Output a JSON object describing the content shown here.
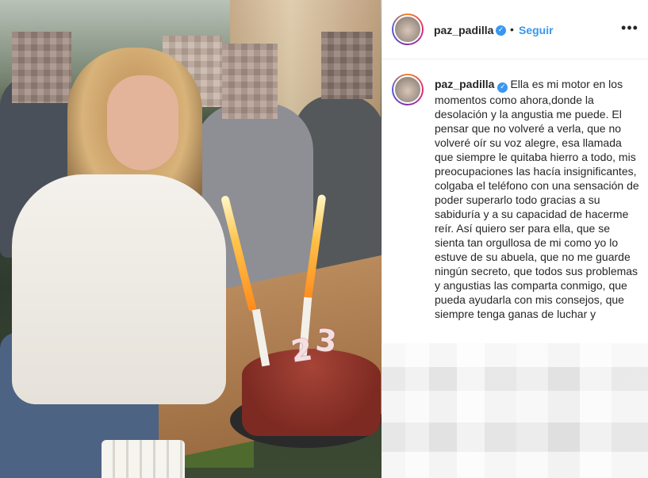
{
  "post": {
    "username": "paz_padilla",
    "follow_label": "Seguir",
    "dot_separator": "•",
    "more_icon": "more-horizontal-icon",
    "verified_icon": "verified-badge-icon",
    "caption": "Ella es mi motor en los momentos como ahora,donde la desolación y la angustia me puede. El pensar que no volveré a verla, que no volveré oír su voz alegre, esa llamada que siempre le quitaba hierro a todo, mis preocupaciones las hacía insignificantes, colgaba el teléfono con una sensación de poder superarlo todo gracias a su sabiduría y a su capacidad de hacerme reír. Así quiero ser para ella, que se sienta tan orgullosa de mi como yo lo estuve de su abuela, que no me guarde ningún secreto, que todos sus problemas y angustias las comparta conmigo, que pueda ayudarla con mis consejos, que siempre tenga ganas de luchar y"
  },
  "photo": {
    "candle_numbers": [
      "2",
      "3"
    ]
  },
  "colors": {
    "link_blue": "#3897f0",
    "text": "#262626",
    "border": "#efefef"
  }
}
